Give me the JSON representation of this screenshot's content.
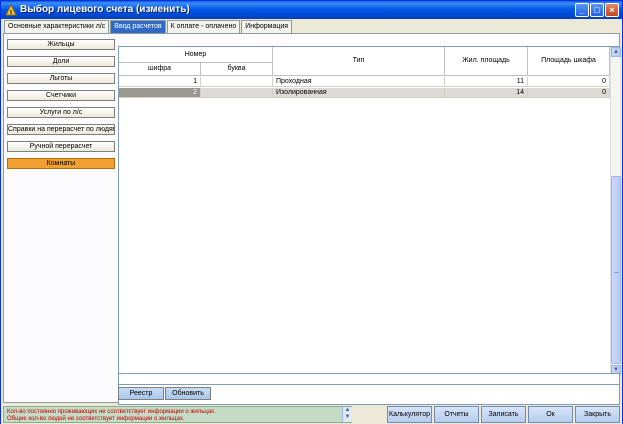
{
  "window": {
    "title": "Выбор лицевого счета (изменить)"
  },
  "tabs": [
    {
      "label": "Основные характеристики л/с",
      "active": false
    },
    {
      "label": "Ввод расчетов",
      "active": true
    },
    {
      "label": "К оплате - оплачено",
      "active": false
    },
    {
      "label": "Информация",
      "active": false
    }
  ],
  "nav": [
    {
      "label": "Жильцы",
      "active": false
    },
    {
      "label": "Доли",
      "active": false
    },
    {
      "label": "Льготы",
      "active": false
    },
    {
      "label": "Счетчики",
      "active": false
    },
    {
      "label": "Услуги по л/с",
      "active": false
    },
    {
      "label": "Справки на перерасчет по людям",
      "active": false
    },
    {
      "label": "Ручной перерасчет",
      "active": false
    },
    {
      "label": "Комнаты",
      "active": true
    }
  ],
  "table": {
    "headers": {
      "number_group": "Номер",
      "digit": "шифра",
      "letter": "буква",
      "type": "Тип",
      "living_area": "Жил. площадь",
      "closet_area": "Площадь шкафа"
    },
    "rows": [
      {
        "digit": "1",
        "letter": "",
        "type": "Проходная",
        "living_area": "11",
        "closet_area": "0",
        "selected": false
      },
      {
        "digit": "2",
        "letter": "",
        "type": "Изолированная",
        "living_area": "14",
        "closet_area": "0",
        "selected": true
      }
    ]
  },
  "grid_buttons": {
    "registry": "Реестр",
    "refresh": "Обновить"
  },
  "warnings": [
    "Кол-во постоянно проживающих не соответствует информации о жильцах.",
    "Общее кол-во людей не соответствует информации о жильцах."
  ],
  "actions": {
    "calculator": "Калькулятор",
    "reports": "Отчеты",
    "save": "Записать",
    "ok": "Ок",
    "close": "Закрыть"
  },
  "colors": {
    "title_bar": "#0058e6",
    "active_tab": "#316ac5",
    "active_nav": "#f0a030",
    "warning_text": "#c00000"
  }
}
